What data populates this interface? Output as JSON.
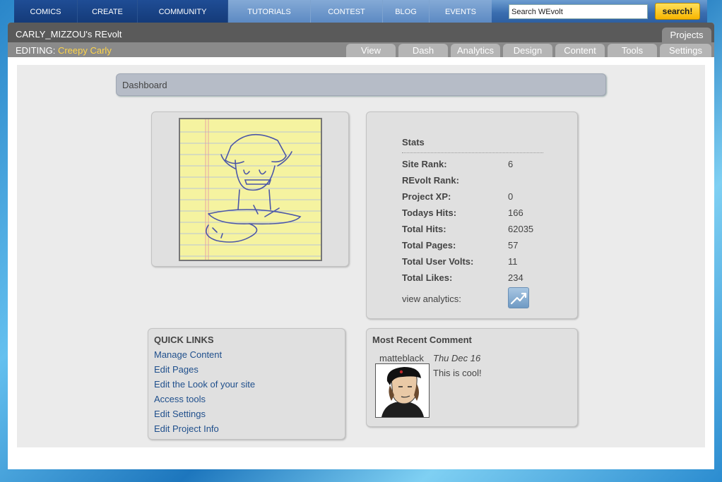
{
  "nav": {
    "items": [
      "COMICS",
      "CREATE",
      "COMMUNITY",
      "TUTORIALS",
      "CONTEST",
      "BLOG",
      "EVENTS"
    ],
    "search_placeholder": "Search WEvolt",
    "search_button": "search!"
  },
  "header": {
    "site_title": "CARLY_MIZZOU's REvolt",
    "projects_tab": "Projects",
    "editing_label": "EDITING:",
    "editing_project": "Creepy Carly",
    "tabs": [
      "View",
      "Dash",
      "Analytics",
      "Design",
      "Content",
      "Tools",
      "Settings"
    ]
  },
  "dashboard": {
    "title": "Dashboard"
  },
  "stats": {
    "title": "Stats",
    "rows": [
      {
        "label": "Site Rank:",
        "value": "6"
      },
      {
        "label": "REvolt Rank:",
        "value": ""
      },
      {
        "label": "Project XP:",
        "value": "0"
      },
      {
        "label": "Todays Hits:",
        "value": "166"
      },
      {
        "label": "Total Hits:",
        "value": "62035"
      },
      {
        "label": "Total Pages:",
        "value": "57"
      },
      {
        "label": "Total User Volts:",
        "value": "11"
      },
      {
        "label": "Total Likes:",
        "value": "234"
      }
    ],
    "view_analytics": "view analytics:"
  },
  "quick_links": {
    "title": "QUICK LINKS",
    "items": [
      "Manage Content",
      "Edit Pages",
      "Edit the Look of your site",
      "Access tools",
      "Edit Settings",
      "Edit Project Info"
    ]
  },
  "recent_comment": {
    "title": "Most Recent Comment",
    "user": "matteblack",
    "date": "Thu Dec 16",
    "text": "This is cool!"
  },
  "colors": {
    "nav_dark": "#1f4d95",
    "nav_light": "#84aad6",
    "search_button": "#f7b500",
    "title_bar": "#5a5a5a",
    "edit_bar": "#8a8a8a",
    "project_name": "#ffd54a",
    "link": "#1f4f8c"
  }
}
